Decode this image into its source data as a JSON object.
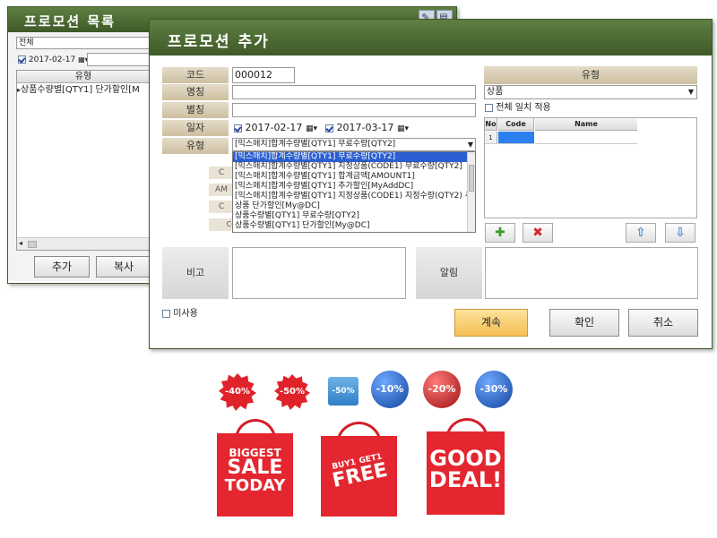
{
  "list_window": {
    "title": "프로모션 목록",
    "filter_value": "전체",
    "date": "2017-02-17",
    "column_header": "유형",
    "row_text": "상품수량별[QTY1] 단가할인[M",
    "buttons": [
      "추가",
      "복사"
    ]
  },
  "add_window": {
    "title": "프로모션 추가",
    "labels": {
      "code": "코드",
      "name": "명칭",
      "alias": "별칭",
      "date": "일자",
      "type": "유형",
      "note": "비고",
      "alert": "알림"
    },
    "code_value": "000012",
    "date_from": "2017-02-17",
    "date_to": "2017-03-17",
    "type_selected": "[믹스매치]합계수량별[QTY1] 무료수량[QTY2]",
    "type_options": [
      "[믹스매치]합계수량별[QTY1] 무료수량[QTY2]",
      "[믹스매치]합계수량별[QTY1] 지정상품(CODE1) 무료수량[QTY2]",
      "[믹스매치]합계수량별[QTY1] 합계금액[AMOUNT1]",
      "[믹스매치]합계수량별[QTY1] 추가할인[MyAddDC]",
      "[믹스매치]합계수량별[QTY1] 지정상품(CODE1) 지정수량(QTY2) 추",
      "상품 단가할인[My@DC]",
      "상품수량별[QTY1] 무료수량[QTY2]",
      "상품수량별[QTY1] 단가할인[My@DC]"
    ],
    "hidden_labels": [
      "C",
      "AM",
      "C",
      "CODE 2"
    ],
    "right_panel": {
      "header": "유형",
      "select_value": "상품",
      "match_all_label": "전체 일치 적용",
      "grid_headers": [
        "No",
        "Code",
        "Name"
      ],
      "grid_row_no": "1"
    },
    "unused_label": "미사용",
    "buttons": {
      "continue": "계속",
      "confirm": "확인",
      "cancel": "취소"
    }
  },
  "decorations": {
    "badges": [
      "-40%",
      "-50%",
      "-50%",
      "-10%",
      "-20%",
      "-30%"
    ],
    "bags": [
      {
        "lines": [
          "BIGGEST",
          "SALE",
          "TODAY"
        ]
      },
      {
        "lines": [
          "BUY1",
          "GET1",
          "FREE"
        ]
      },
      {
        "lines": [
          "GOOD",
          "DEAL!"
        ]
      }
    ]
  },
  "colors": {
    "title_bar": "#4b6b32",
    "label_bg": "#d8cdb3",
    "selection": "#2b5fd1",
    "accent_button": "#f6c65e",
    "sale_red": "#e3262f"
  }
}
